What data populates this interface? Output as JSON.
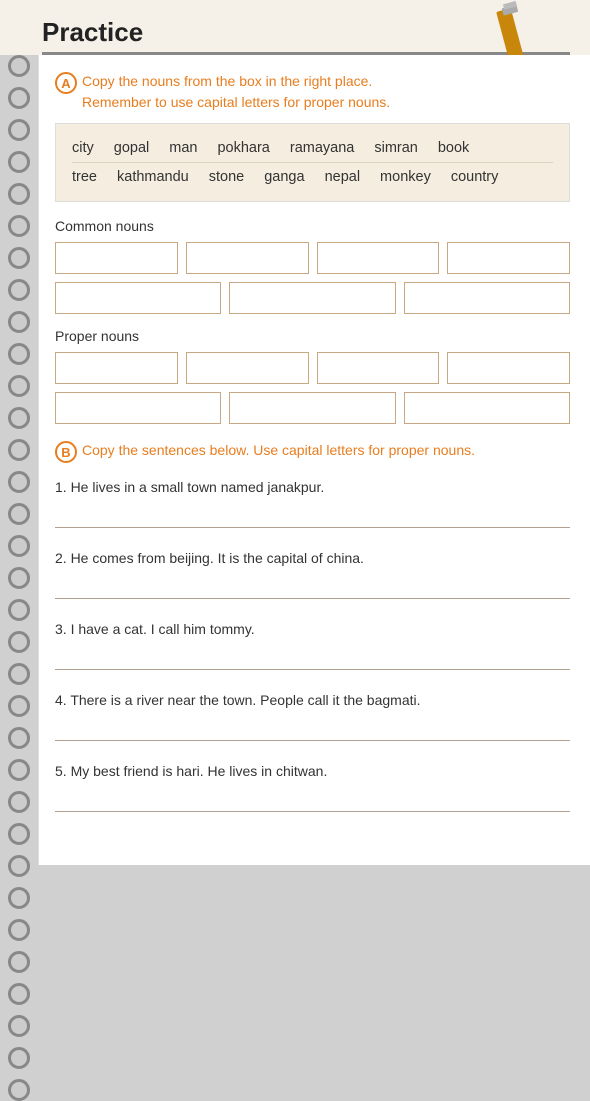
{
  "title": "Practice",
  "sections": {
    "a": {
      "letter": "A",
      "instruction_line1": "Copy the nouns from the box in the right place.",
      "instruction_line2": "Remember to use capital letters for proper nouns.",
      "word_box": {
        "row1": [
          "city",
          "gopal",
          "man",
          "pokhara",
          "ramayana",
          "simran",
          "book"
        ],
        "row2": [
          "tree",
          "kathmandu",
          "stone",
          "ganga",
          "nepal",
          "monkey",
          "country"
        ]
      },
      "common_nouns_label": "Common nouns",
      "proper_nouns_label": "Proper nouns"
    },
    "b": {
      "letter": "B",
      "instruction": "Copy the sentences below. Use capital letters for proper nouns.",
      "sentences": [
        "1. He lives in a small town named janakpur.",
        "2. He comes from beijing. It is the capital of china.",
        "3. I have a cat. I call him tommy.",
        "4. There is a river near the town. People call it the bagmati.",
        "5. My best friend is hari. He lives in chitwan."
      ]
    }
  }
}
